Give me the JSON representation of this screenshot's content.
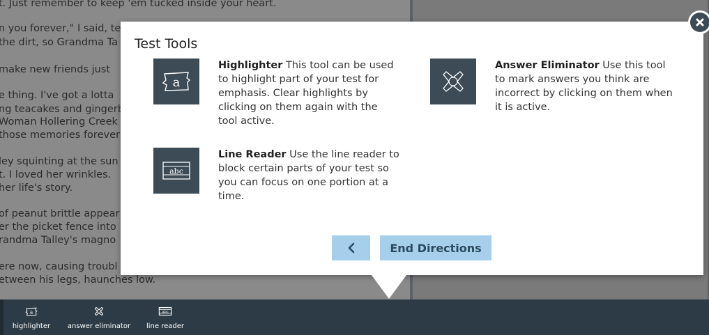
{
  "passage": {
    "lines": [
      "t. Just remember to keep 'em tucked inside your heart.",
      "n you forever,\" I said, te",
      "the dirt, so Grandma Ta",
      "make new friends just",
      "e thing. I've got a lotta",
      "ng teacakes and gingerb",
      "Woman Hollering Creek",
      "those memories forever",
      "ley squinting at the sun",
      "t. I loved her wrinkles.",
      "her life's story.",
      "of peanut brittle appear",
      "er the picket fence into",
      "randma Talley's magno",
      "ere now, causing troubl",
      "etween his legs, haunches low."
    ]
  },
  "modal": {
    "title": "Test Tools",
    "tools": [
      {
        "icon": "highlighter-icon",
        "name": "Highlighter",
        "description": " This tool can be used to highlight part of your test for emphasis. Clear highlights by clicking on them again with the tool active."
      },
      {
        "icon": "answer-eliminator-icon",
        "name": "Answer Eliminator",
        "description": " Use this tool to mark answers you think are incorrect by clicking on them when it is active."
      },
      {
        "icon": "line-reader-icon",
        "name": "Line Reader",
        "description": " Use the line reader to block certain parts of your test so you can focus on one portion at a time."
      }
    ],
    "back_label": "<",
    "end_label": "End Directions"
  },
  "toolbar": {
    "items": [
      {
        "icon": "highlighter-icon",
        "label": "highlighter"
      },
      {
        "icon": "answer-eliminator-icon",
        "label": "answer eliminator"
      },
      {
        "icon": "line-reader-icon",
        "label": "line reader"
      }
    ]
  },
  "colors": {
    "icon_bg": "#3d4b56",
    "button_bg": "#a6cfec",
    "toolbar_bg": "#2d3b46",
    "modal_bg": "#ffffff"
  }
}
